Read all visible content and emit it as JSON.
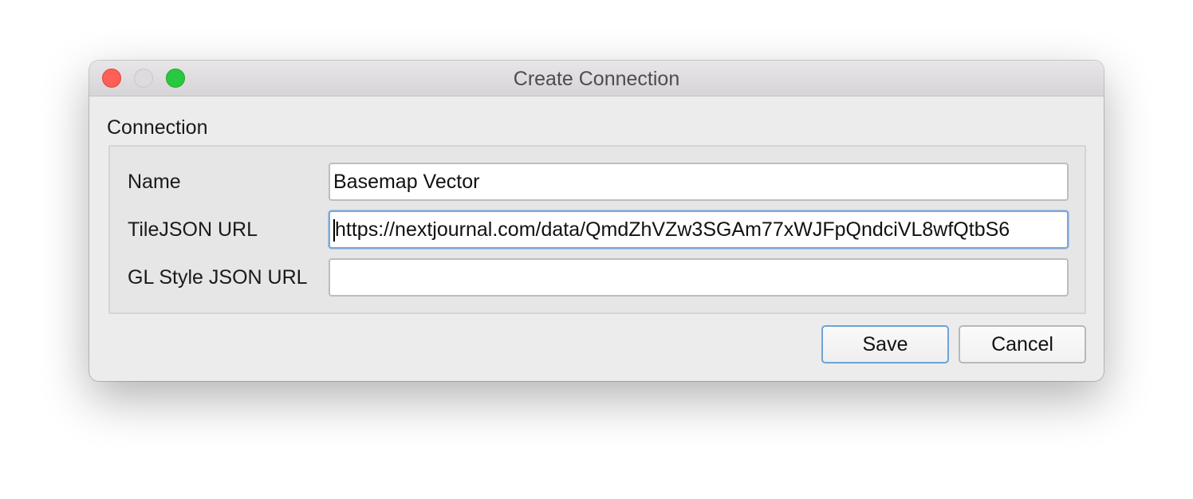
{
  "window": {
    "title": "Create Connection"
  },
  "group": {
    "label": "Connection"
  },
  "fields": [
    {
      "label": "Name",
      "value": "Basemap Vector"
    },
    {
      "label": "TileJSON URL",
      "value": "https://nextjournal.com/data/QmdZhVZw3SGAm77xWJFpQndciVL8wfQtbS6"
    },
    {
      "label": "GL Style JSON URL",
      "value": ""
    }
  ],
  "buttons": {
    "save_label": "Save",
    "cancel_label": "Cancel"
  },
  "colors": {
    "close": "#fe5f57",
    "minimize_disabled": "#dcdcdc",
    "zoom": "#28c840",
    "focus_ring": "#7ea6d4"
  }
}
